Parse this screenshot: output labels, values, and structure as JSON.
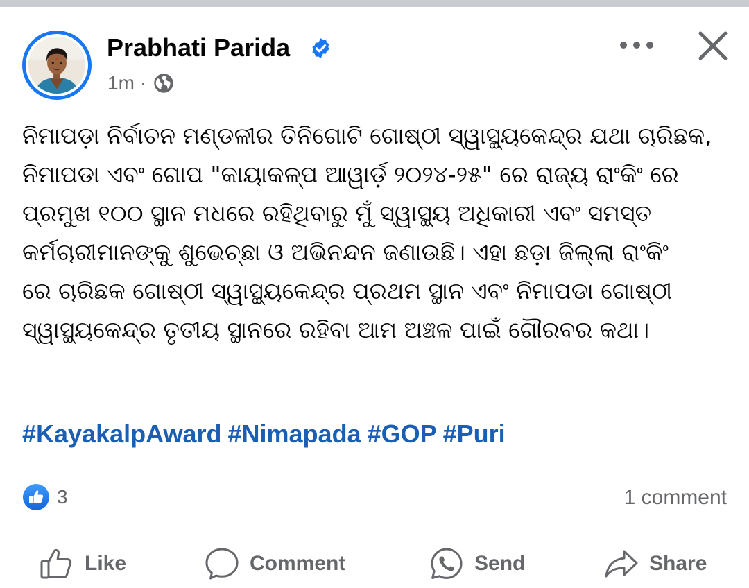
{
  "post": {
    "author": "Prabhati Parida",
    "timestamp": "1m",
    "separator": "·",
    "audience_icon": "globe-icon",
    "verified_icon": "verified-badge-icon",
    "text_lines": [
      "ନିମାପଡ଼ା ନିର୍ବାଚନ ମଣ୍ଡଳୀର ତିନିଗୋଟି ଗୋଷ୍ଠୀ ସ୍ୱାସ୍ଥ୍ୟକେନ୍ଦ୍ର ଯଥା ଚାରିଛକ,",
      "ନିମାପଡା ଏବଂ ଗୋପ \"କାୟାକଳ୍ପ ଆୱାର୍ଡ଼ ୨୦୨୪-୨୫\" ରେ ରାଜ୍ୟ ରାଂକିଂ ରେ",
      "ପ୍ରମୁଖ ୧୦୦ ସ୍ଥାନ ମଧରେ ରହିଥିବାରୁ ମୁଁ ସ୍ୱାସ୍ଥ୍ୟ ଅଧିକାରୀ ଏବଂ ସମସ୍ତ",
      "କର୍ମଚାରୀମାନଙ୍କୁ ଶୁଭେଚ୍ଛା ଓ ଅଭିନନ୍ଦନ ଜଣାଉଛି। ଏହା ଛଡ଼ା ଜିଲ୍ଲା ରାଂକିଂ",
      "ରେ ଚାରିଛକ ଗୋଷ୍ଠୀ ସ୍ୱାସ୍ଥ୍ୟକେନ୍ଦ୍ର ପ୍ରଥମ ସ୍ଥାନ ଏବଂ ନିମାପଡା ଗୋଷ୍ଠୀ",
      "ସ୍ୱାସ୍ଥ୍ୟକେନ୍ଦ୍ର ତୃତୀୟ ସ୍ଥାନରେ ରହିବା ଆମ ଅଞ୍ଚଳ ପାଇଁ ଗୌରବର କଥା।"
    ],
    "hashtags": [
      "#KayakalpAward",
      "#Nimapada",
      "#GOP",
      "#Puri"
    ],
    "reaction_count": "3",
    "comment_count": "1 comment"
  },
  "actions": {
    "like": "Like",
    "comment": "Comment",
    "send": "Send",
    "share": "Share"
  },
  "colors": {
    "accent": "#1877f2",
    "hashtag": "#1a5fb4",
    "muted": "#65676b",
    "text": "#050505"
  }
}
